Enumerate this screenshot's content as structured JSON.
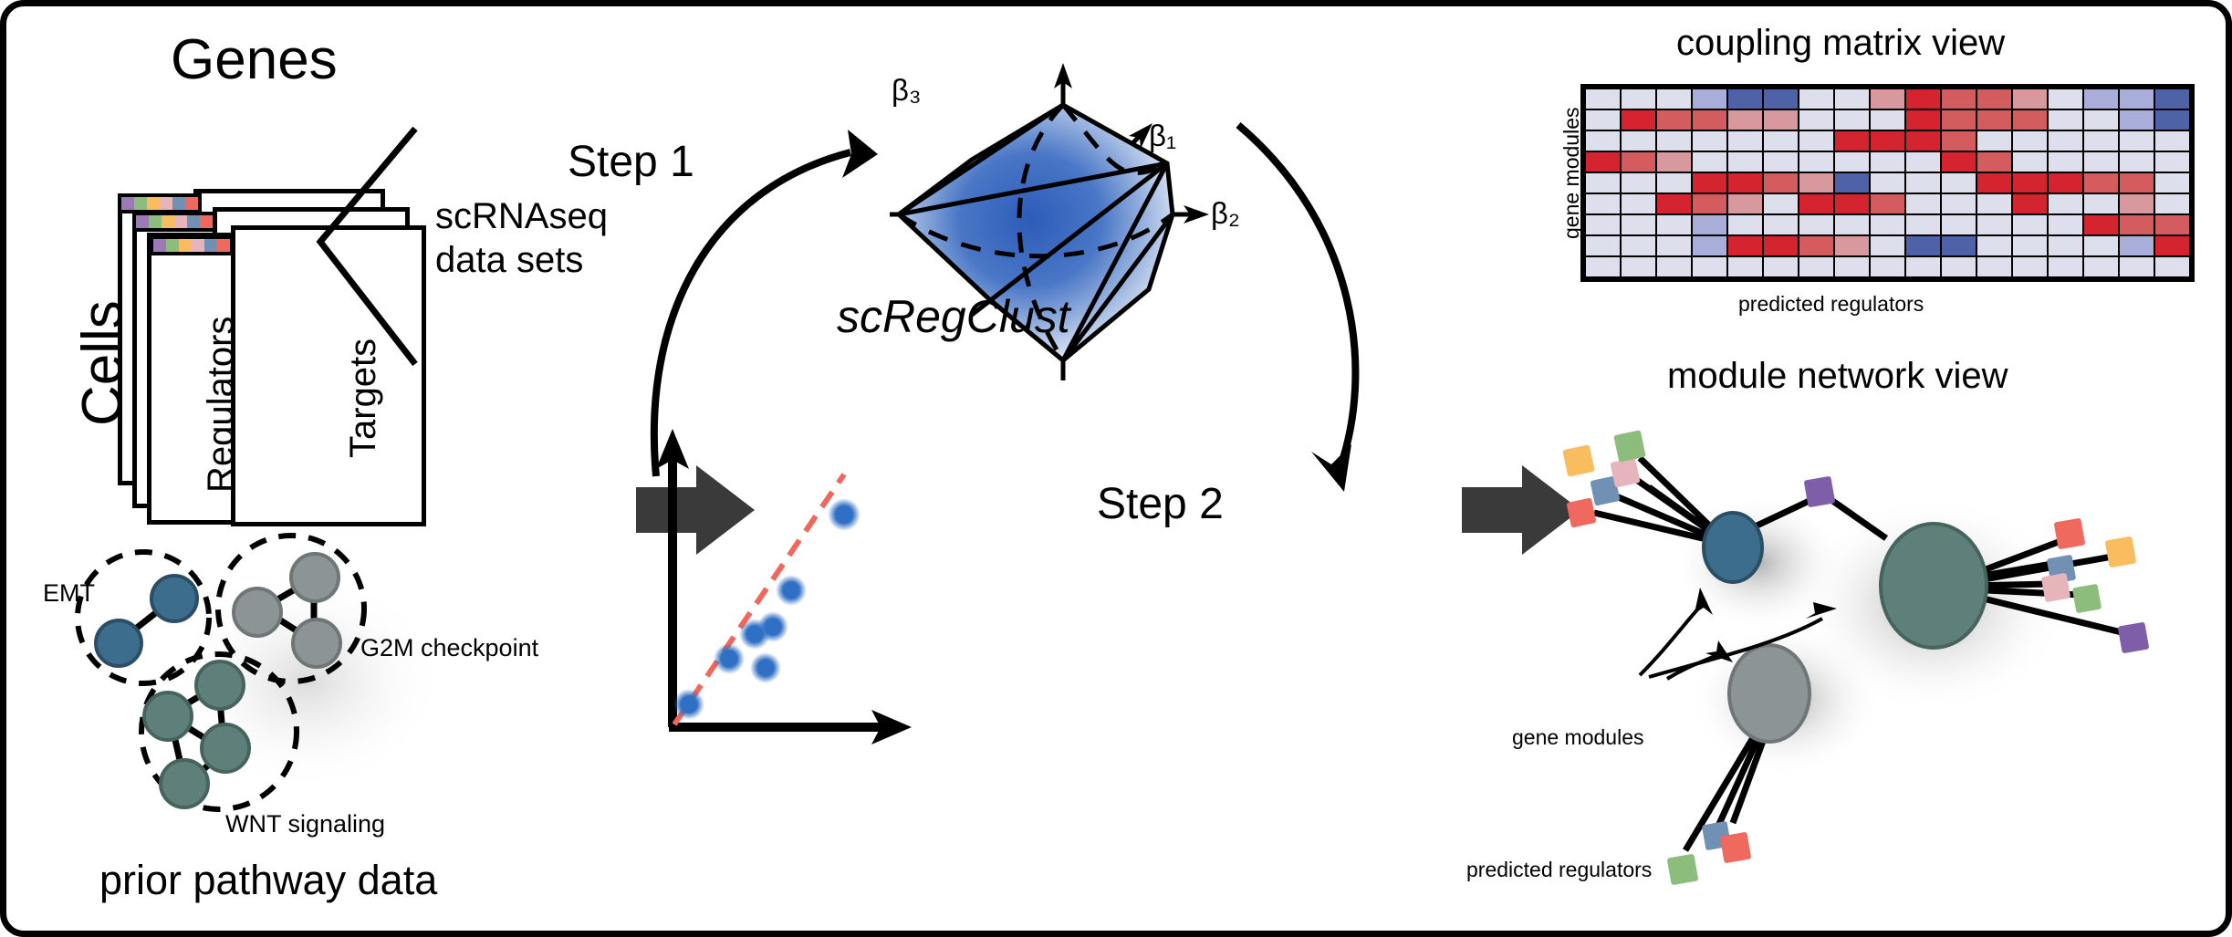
{
  "figure": {
    "background": "#ffffff",
    "border_color": "#000000",
    "arrow_color": "#3a3a3a"
  },
  "data_panel": {
    "top_label": "Genes",
    "side_label": "Cells",
    "sheet_labels": [
      "Regulators",
      "Targets"
    ],
    "bracket_label_line1": "scRNAseq",
    "bracket_label_line2": "data sets",
    "strip_colors": [
      "#9b7ab5",
      "#8cbd7c",
      "#f9bc5e",
      "#e6b5bc",
      "#7091b4",
      "#f0695f"
    ]
  },
  "prior_panel": {
    "caption": "prior pathway data",
    "clusters": [
      {
        "name": "EMT",
        "label": "EMT",
        "node_color": "#3d6d8c",
        "nodes": 2
      },
      {
        "name": "G2M checkpoint",
        "label": "G2M checkpoint",
        "node_color": "#8d9495",
        "nodes": 3
      },
      {
        "name": "WNT signaling",
        "label": "WNT signaling",
        "node_color": "#5f807a",
        "nodes": 4
      }
    ]
  },
  "middle_panel": {
    "method_name": "scRegClust",
    "step1_label": "Step 1",
    "step2_label": "Step 2",
    "axis_labels": {
      "beta1": "β₁",
      "beta2": "β₂",
      "beta3": "β₃"
    },
    "polytope_color": "#2b5cb8",
    "scatter": {
      "point_color": "#2f6fc4",
      "fit_line_color": "#f2665c",
      "points": [
        [
          0.08,
          0.08
        ],
        [
          0.3,
          0.32
        ],
        [
          0.41,
          0.22
        ],
        [
          0.47,
          0.15
        ],
        [
          0.5,
          0.44
        ],
        [
          0.62,
          0.57
        ],
        [
          0.9,
          0.82
        ]
      ]
    }
  },
  "right_panel": {
    "matrix_title": "coupling matrix view",
    "matrix_ylabel": "gene modules",
    "matrix_xlabel": "predicted regulators",
    "network_title": "module network view",
    "network_module_label": "gene modules",
    "network_regulator_label": "predicted regulators",
    "module_colors": [
      "#3d6d8c",
      "#5f807a",
      "#8d9495"
    ],
    "regulator_palette": [
      "#9b7ab5",
      "#8cbd7c",
      "#f9bc5e",
      "#e6b5bc",
      "#7091b4",
      "#f0695f"
    ]
  },
  "chart_data": {
    "type": "heatmap",
    "title": "coupling matrix view",
    "xlabel": "predicted regulators",
    "ylabel": "gene modules",
    "rows": 9,
    "cols": 17,
    "colorscale": {
      "name": "RdBu (diverging)",
      "stops": [
        {
          "value": -1.0,
          "color": "#4f62a8"
        },
        {
          "value": -0.5,
          "color": "#a8adda"
        },
        {
          "value": 0.0,
          "color": "#dddfec"
        },
        {
          "value": 0.5,
          "color": "#d46a6a"
        },
        {
          "value": 1.0,
          "color": "#d32430"
        }
      ]
    },
    "values": [
      [
        0.0,
        0.0,
        0.0,
        -0.5,
        -1.0,
        -1.0,
        0.0,
        0.0,
        0.3,
        1.0,
        0.6,
        0.6,
        0.3,
        0.0,
        -0.5,
        -0.5,
        -1.0
      ],
      [
        0.0,
        1.0,
        0.6,
        0.6,
        0.3,
        0.3,
        0.0,
        0.0,
        0.0,
        1.0,
        0.6,
        0.6,
        0.6,
        0.0,
        0.0,
        -0.5,
        -1.0
      ],
      [
        0.0,
        0.0,
        0.0,
        0.0,
        0.0,
        0.0,
        0.0,
        1.0,
        1.0,
        1.0,
        0.6,
        0.0,
        0.0,
        0.0,
        0.0,
        0.0,
        0.0
      ],
      [
        1.0,
        0.6,
        0.3,
        0.0,
        0.0,
        0.0,
        0.0,
        0.0,
        0.0,
        0.0,
        1.0,
        0.6,
        0.0,
        0.0,
        0.0,
        0.0,
        0.0
      ],
      [
        0.0,
        0.0,
        0.0,
        1.0,
        1.0,
        0.6,
        0.3,
        -1.0,
        0.0,
        0.0,
        0.0,
        1.0,
        1.0,
        1.0,
        0.6,
        0.6,
        0.0
      ],
      [
        0.0,
        0.0,
        1.0,
        0.6,
        0.3,
        0.0,
        1.0,
        1.0,
        0.6,
        0.0,
        0.0,
        0.0,
        1.0,
        0.0,
        0.0,
        0.3,
        0.0
      ],
      [
        0.0,
        0.0,
        0.0,
        -0.5,
        0.0,
        0.0,
        0.0,
        0.0,
        0.0,
        0.0,
        0.0,
        0.0,
        0.0,
        0.0,
        1.0,
        0.6,
        0.6
      ],
      [
        0.0,
        0.0,
        0.0,
        -0.5,
        1.0,
        1.0,
        0.6,
        0.3,
        0.0,
        -1.0,
        -1.0,
        0.0,
        0.0,
        0.0,
        0.0,
        -0.5,
        1.0
      ],
      [
        0.0,
        0.0,
        0.0,
        0.0,
        0.0,
        0.0,
        0.0,
        0.0,
        0.0,
        0.0,
        0.0,
        0.0,
        0.0,
        0.0,
        0.0,
        0.0,
        0.0
      ]
    ]
  }
}
